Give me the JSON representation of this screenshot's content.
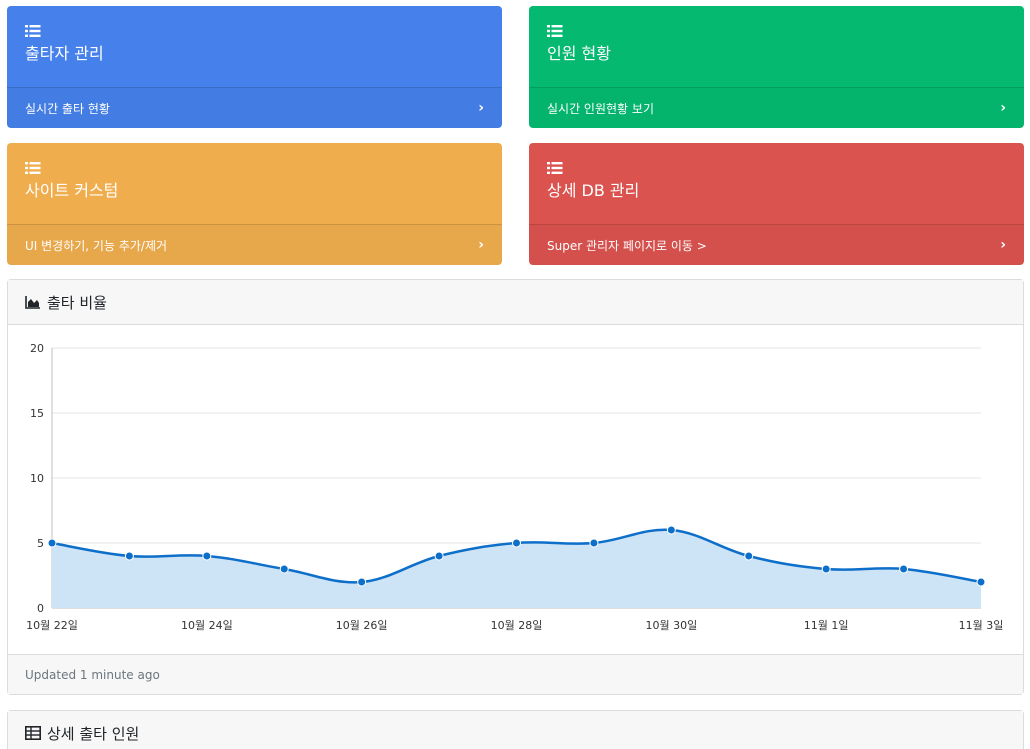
{
  "cards": [
    {
      "title": "출타자 관리",
      "link": "실시간 출타 현황",
      "color": "#4680ea"
    },
    {
      "title": "인원 현황",
      "link": "실시간 인원현황 보기",
      "color": "#05b970"
    },
    {
      "title": "사이트 커스텀",
      "link": "UI 변경하기, 기능 추가/제거",
      "color": "#efad4e"
    },
    {
      "title": "상세 DB 관리",
      "link": "Super 관리자 페이지로 이동 >",
      "color": "#db534f"
    }
  ],
  "chart_panel": {
    "title": "출타 비율",
    "icon": "area-chart-icon",
    "footer": "Updated 1 minute ago"
  },
  "table_panel": {
    "title": "상세 출타 인원",
    "icon": "table-icon"
  },
  "chart_data": {
    "type": "area",
    "x": [
      "10월 22일",
      "10월 23일",
      "10월 24일",
      "10월 25일",
      "10월 26일",
      "10월 27일",
      "10월 28일",
      "10월 29일",
      "10월 30일",
      "10월 31일",
      "11월 1일",
      "11월 2일",
      "11월 3일"
    ],
    "tick_labels": [
      "10월 22일",
      "10월 24일",
      "10월 26일",
      "10월 28일",
      "10월 30일",
      "11월 1일",
      "11월 3일"
    ],
    "values": [
      5,
      4,
      4,
      3,
      2,
      4,
      5,
      5,
      6,
      4,
      3,
      3,
      2
    ],
    "y_ticks": [
      "0",
      "5",
      "10",
      "15",
      "20"
    ],
    "ylim": [
      0,
      20
    ],
    "grid": true,
    "line_color": "#0d6fc9",
    "fill_color": "#cde3f6"
  }
}
